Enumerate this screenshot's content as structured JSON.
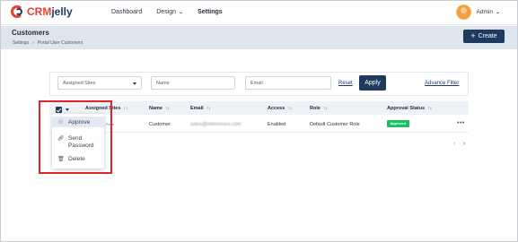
{
  "brand": {
    "crm": "CRM",
    "jelly": "jelly"
  },
  "nav": {
    "dashboard": "Dashboard",
    "design": "Design",
    "settings": "Settings"
  },
  "user": {
    "name": "Admin"
  },
  "header": {
    "title": "Customers",
    "breadcrumb": [
      "Settings",
      "Portal User Customers"
    ],
    "create_label": "Create"
  },
  "filters": {
    "assigned_sites_placeholder": "Assigned Sites",
    "name_placeholder": "Name",
    "email_placeholder": "Email",
    "reset_label": "Reset",
    "apply_label": "Apply",
    "advance_filter_label": "Advance Filter"
  },
  "table": {
    "columns": [
      "Assigned Sites",
      "Name",
      "Email",
      "Access",
      "Role",
      "Approval Status"
    ],
    "sort_glyph": "↑↓",
    "rows": [
      {
        "assigned_sites": "Portal",
        "name": "Customer",
        "email": "sales@ebtechnics.com",
        "access": "Enabled",
        "role": "Default Customer Role",
        "approval_status": "Approved"
      }
    ]
  },
  "bulk_menu": {
    "items": [
      {
        "label": "Approve",
        "icon": "approve-icon"
      },
      {
        "label": "Send Password",
        "icon": "link-icon"
      },
      {
        "label": "Delete",
        "icon": "trash-icon"
      }
    ]
  },
  "colors": {
    "primary": "#1f3a5f",
    "brand_red": "#e4432d",
    "approved": "#1cbf5f",
    "highlight": "#e0242b",
    "header_band": "#dfe5ee"
  }
}
